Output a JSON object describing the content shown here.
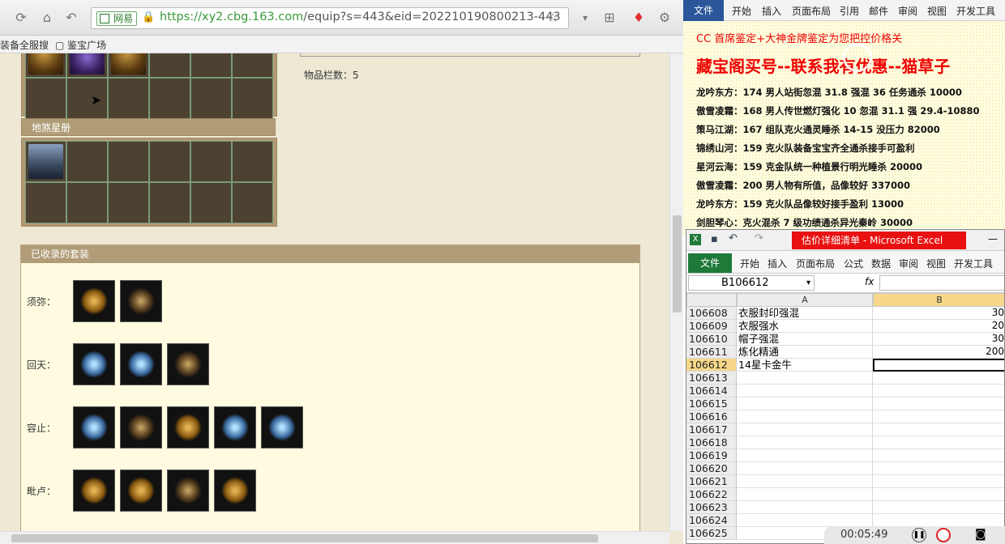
{
  "browser": {
    "site_label": "网易",
    "url_https": "https://",
    "url_domain": "xy2.cbg.163.com",
    "url_rest": "/equip?s=443&eid=202210190800213-443",
    "bookmark_1": "装备全服搜",
    "bookmark_2": "鉴宝广场",
    "item_count_label": "物品栏数：5",
    "panel_title": "地煞星册",
    "suits_title": "已收录的套装",
    "suits": [
      {
        "label": "须弥：",
        "icons": [
          "g-gold",
          "g-dark"
        ]
      },
      {
        "label": "回天：",
        "icons": [
          "g-blue",
          "g-blue",
          "g-dark"
        ]
      },
      {
        "label": "容止：",
        "icons": [
          "g-blue",
          "g-dark",
          "g-gold",
          "g-blue",
          "g-blue"
        ]
      },
      {
        "label": "毗卢：",
        "icons": [
          "g-gold",
          "g-gold",
          "g-dark",
          "g-gold"
        ]
      }
    ]
  },
  "word": {
    "tabs": [
      "文件",
      "开始",
      "插入",
      "页面布局",
      "引用",
      "邮件",
      "审阅",
      "视图",
      "开发工具"
    ],
    "line1": "CC 首席鉴定+大神金牌鉴定为您把控价格关",
    "line2": "藏宝阁买号--联系我有优惠--猫草子",
    "lines": [
      "龙吟东方：174 男人站街忽混 31.8 强混 36 任务通杀 10000",
      "傲雪凌霜：168 男人传世燃灯强化 10 忽混 31.1 强 29.4-10880",
      "策马江湖：167 组队克火通灵睡杀 14-15 没压力 82000",
      "锦绣山河：159 克火队装备宝宝齐全通杀接手可盈利",
      "星河云海：159 克金队统一种植景行明光睡杀 20000",
      "傲雪凌霜：200 男人物有所值，品像较好 337000",
      "龙吟东方：159 克火队品像较好接手盈利 13000",
      "剑胆琴心：克火混杀 7 级功绩通杀异光秦岭 30000"
    ]
  },
  "excel": {
    "title": "估价详细清单 - Microsoft Excel",
    "tabs": [
      "文件",
      "开始",
      "插入",
      "页面布局",
      "公式",
      "数据",
      "审阅",
      "视图",
      "开发工具"
    ],
    "namebox": "B106612",
    "fx": "fx",
    "col_a": "A",
    "col_b": "B",
    "rows": [
      {
        "num": "106608",
        "a": "衣服封印强混",
        "b": "30"
      },
      {
        "num": "106609",
        "a": "衣服强水",
        "b": "20"
      },
      {
        "num": "106610",
        "a": "帽子强混",
        "b": "30"
      },
      {
        "num": "106611",
        "a": "炼化精通",
        "b": "200"
      },
      {
        "num": "106612",
        "a": "14星卡金牛",
        "b": ""
      },
      {
        "num": "106613",
        "a": "",
        "b": ""
      },
      {
        "num": "106614",
        "a": "",
        "b": ""
      },
      {
        "num": "106615",
        "a": "",
        "b": ""
      },
      {
        "num": "106616",
        "a": "",
        "b": ""
      },
      {
        "num": "106617",
        "a": "",
        "b": ""
      },
      {
        "num": "106618",
        "a": "",
        "b": ""
      },
      {
        "num": "106619",
        "a": "",
        "b": ""
      },
      {
        "num": "106620",
        "a": "",
        "b": ""
      },
      {
        "num": "106621",
        "a": "",
        "b": ""
      },
      {
        "num": "106622",
        "a": "",
        "b": ""
      },
      {
        "num": "106623",
        "a": "",
        "b": ""
      },
      {
        "num": "106624",
        "a": "",
        "b": ""
      },
      {
        "num": "106625",
        "a": "",
        "b": ""
      }
    ]
  },
  "recorder": {
    "time": "00:05:49"
  }
}
